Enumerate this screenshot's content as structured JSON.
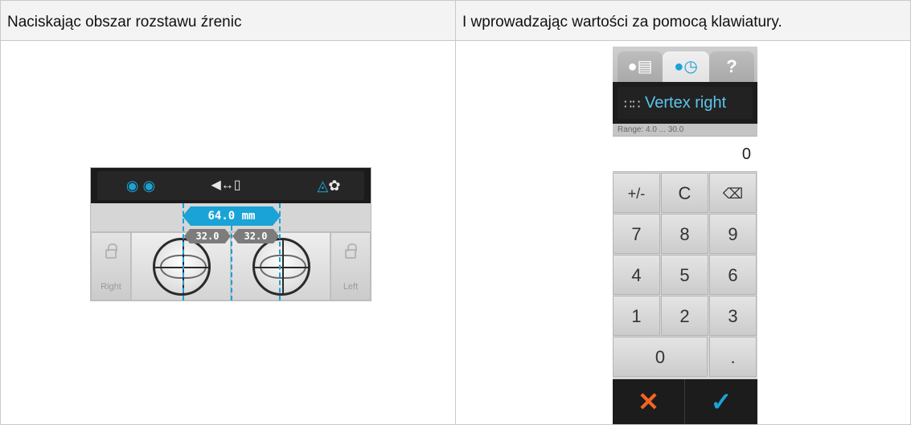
{
  "header": {
    "left_text": "Naciskając obszar rozstawu źrenic",
    "right_text": "I wprowadzając wartości za pomocą klawiatury."
  },
  "pd_panel": {
    "icons": [
      "eyes-distance-icon",
      "vertex-distance-icon",
      "mountain-near-icon"
    ],
    "total_label": "64.0 mm",
    "right_half": "32.0",
    "left_half": "32.0",
    "side_right_label": "Right",
    "side_left_label": "Left"
  },
  "keypad": {
    "tabs": [
      "user-report-icon",
      "user-history-icon",
      "help-icon"
    ],
    "help_glyph": "?",
    "title": "Vertex right",
    "range": "Range: 4.0 ... 30.0",
    "value": "0",
    "keys": {
      "plusminus": "+/-",
      "clear": "C",
      "k7": "7",
      "k8": "8",
      "k9": "9",
      "k4": "4",
      "k5": "5",
      "k6": "6",
      "k1": "1",
      "k2": "2",
      "k3": "3",
      "k0": "0",
      "dot": "."
    },
    "colors": {
      "accent": "#1aa3d6",
      "cancel": "#f26522"
    }
  }
}
